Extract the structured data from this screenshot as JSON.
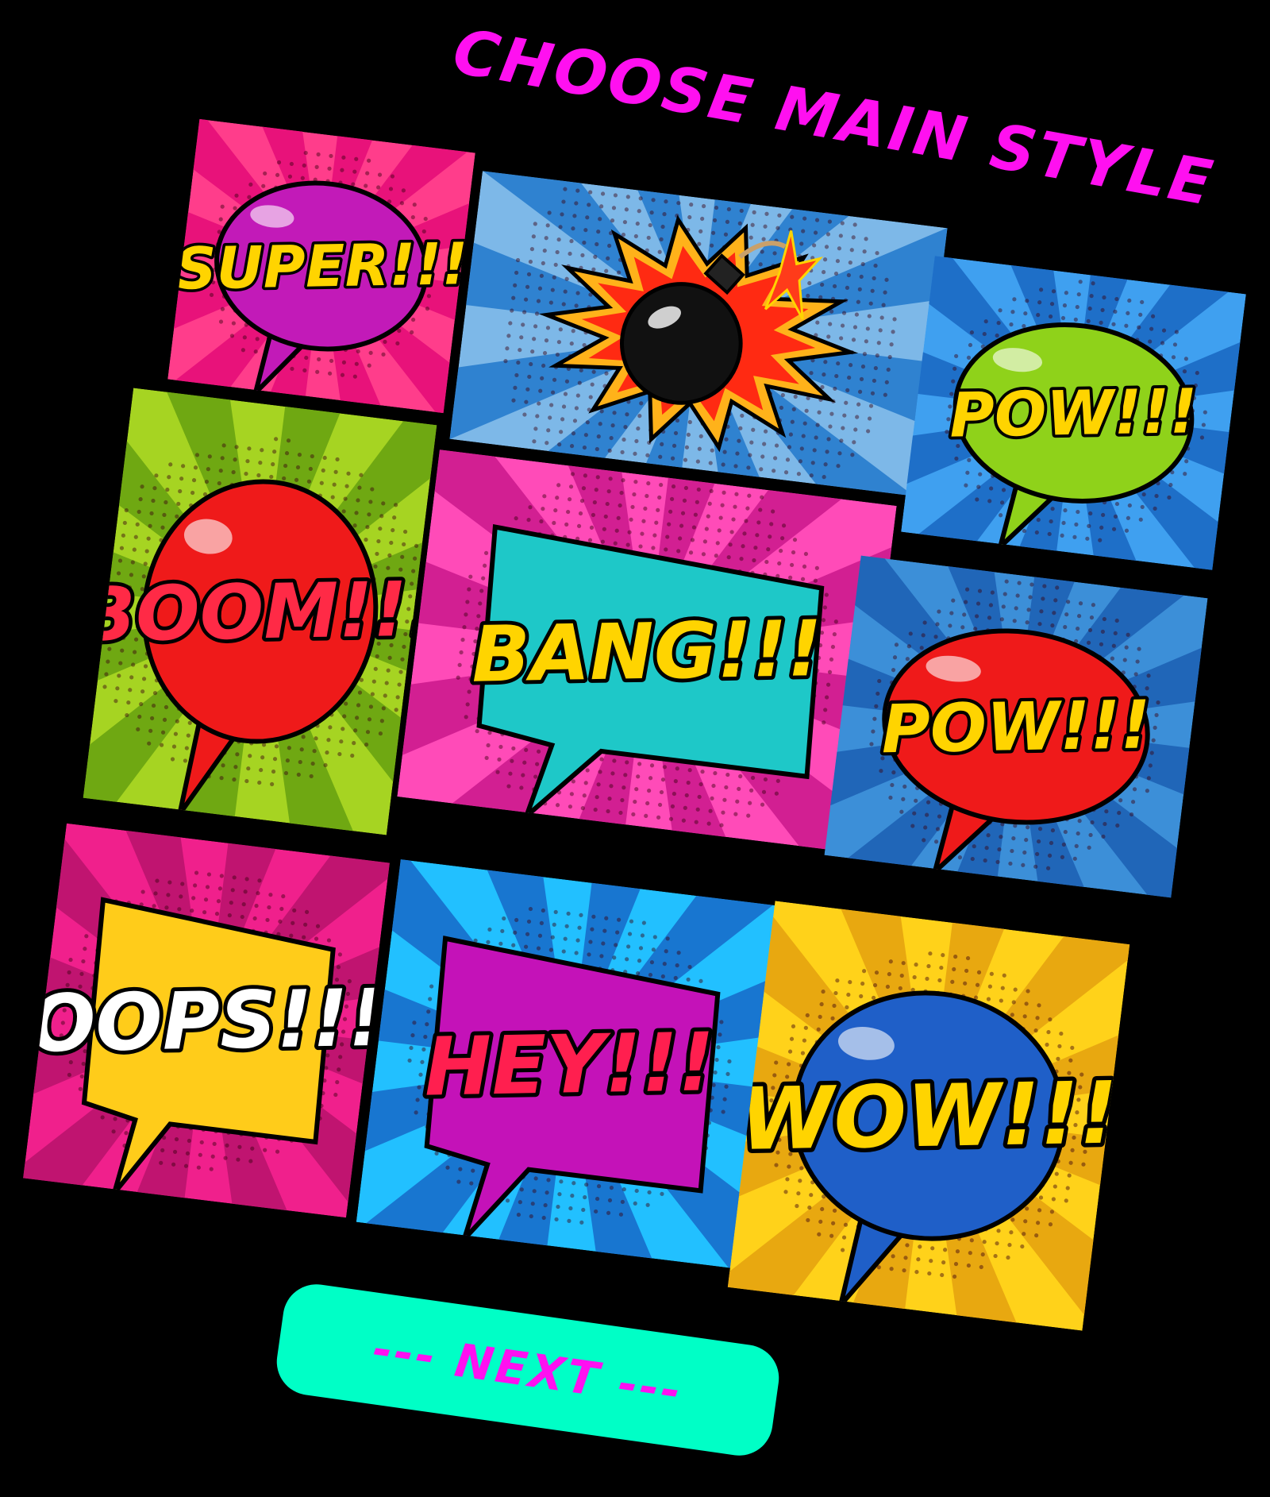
{
  "title": "CHOOSE MAIN STYLE",
  "next_label": "--- NEXT ---",
  "panels": [
    {
      "word": "SUPER!!!",
      "bg1": "#ff3d8b",
      "bg2": "#e8127a",
      "bubble": "#c21ab8",
      "text": "#ffd400"
    },
    {
      "word": "",
      "bg1": "#7db8e8",
      "bg2": "#2f82d0",
      "bubble": "#ff2a12",
      "text": "#000000"
    },
    {
      "word": "POW!!!",
      "bg1": "#3fa0f0",
      "bg2": "#1e6fc8",
      "bubble": "#8fd21a",
      "text": "#ffd400"
    },
    {
      "word": "BOOM!!!",
      "bg1": "#a6d422",
      "bg2": "#6fa812",
      "bubble": "#ef1a1a",
      "text": "#ff2a46"
    },
    {
      "word": "BANG!!!",
      "bg1": "#ff4bb8",
      "bg2": "#d21f92",
      "bubble": "#1ec8c8",
      "text": "#ffd400"
    },
    {
      "word": "POW!!!",
      "bg1": "#3c8fd8",
      "bg2": "#2066b8",
      "bubble": "#ef1a1a",
      "text": "#ffd400"
    },
    {
      "word": "OOPS!!!",
      "bg1": "#f0208c",
      "bg2": "#c01470",
      "bubble": "#ffcc1a",
      "text": "#ffffff"
    },
    {
      "word": "HEY!!!",
      "bg1": "#22c0ff",
      "bg2": "#1876d0",
      "bubble": "#c412b8",
      "text": "#ff1f4f"
    },
    {
      "word": "WOW!!!",
      "bg1": "#ffd21a",
      "bg2": "#e8a810",
      "bubble": "#1f5fc8",
      "text": "#ffd400"
    }
  ]
}
